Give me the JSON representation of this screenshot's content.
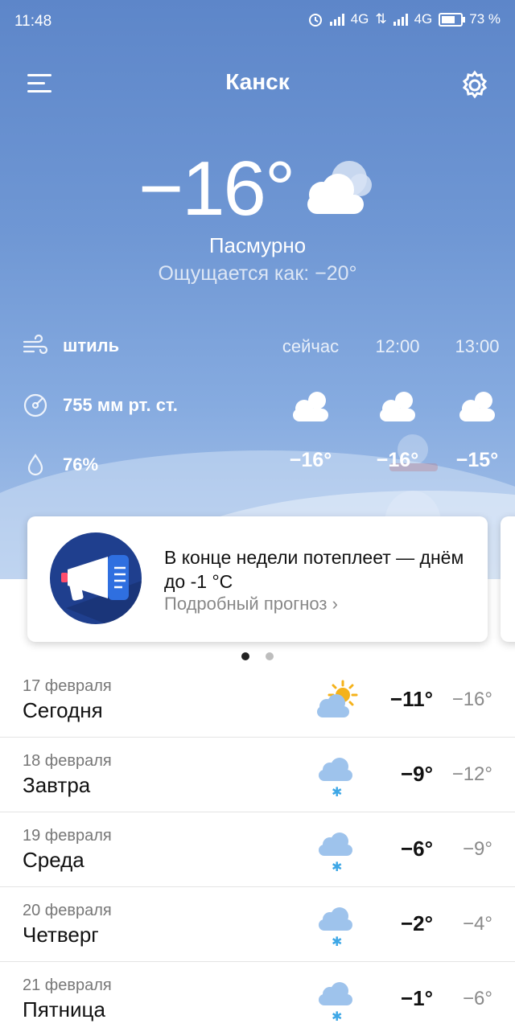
{
  "status_bar": {
    "time": "11:48",
    "network1": "4G",
    "network2": "4G",
    "battery": "73 %"
  },
  "header": {
    "city": "Канск"
  },
  "current": {
    "temperature": "−16°",
    "condition": "Пасмурно",
    "feels_like": "Ощущается как: −20°"
  },
  "details": {
    "wind": "штиль",
    "pressure": "755 мм рт. ст.",
    "humidity": "76%"
  },
  "hourly": [
    {
      "label": "сейчас",
      "temp": "−16°",
      "icon": "cloud-icon"
    },
    {
      "label": "12:00",
      "temp": "−16°",
      "icon": "cloud-icon"
    },
    {
      "label": "13:00",
      "temp": "−15°",
      "icon": "cloud-icon"
    }
  ],
  "promo": {
    "title": "В конце недели потеплеет — днём до -1 °C",
    "link": "Подробный прогноз ›",
    "icon": "megaphone-icon"
  },
  "pager": {
    "active": 0,
    "count": 2
  },
  "days": [
    {
      "date": "17 февраля",
      "name": "Сегодня",
      "hi": "−11°",
      "lo": "−16°",
      "icon": "sun-cloud-icon"
    },
    {
      "date": "18 февраля",
      "name": "Завтра",
      "hi": "−9°",
      "lo": "−12°",
      "icon": "snow-cloud-icon"
    },
    {
      "date": "19 февраля",
      "name": "Среда",
      "hi": "−6°",
      "lo": "−9°",
      "icon": "snow-cloud-icon"
    },
    {
      "date": "20 февраля",
      "name": "Четверг",
      "hi": "−2°",
      "lo": "−4°",
      "icon": "snow-cloud-icon"
    },
    {
      "date": "21 февраля",
      "name": "Пятница",
      "hi": "−1°",
      "lo": "−6°",
      "icon": "snow-cloud-icon"
    }
  ],
  "colors": {
    "accent": "#1f3f8e",
    "sky_top": "#5d86c9",
    "sky_bottom": "#a9c4ea",
    "snow_icon": "#3ea7e6"
  }
}
